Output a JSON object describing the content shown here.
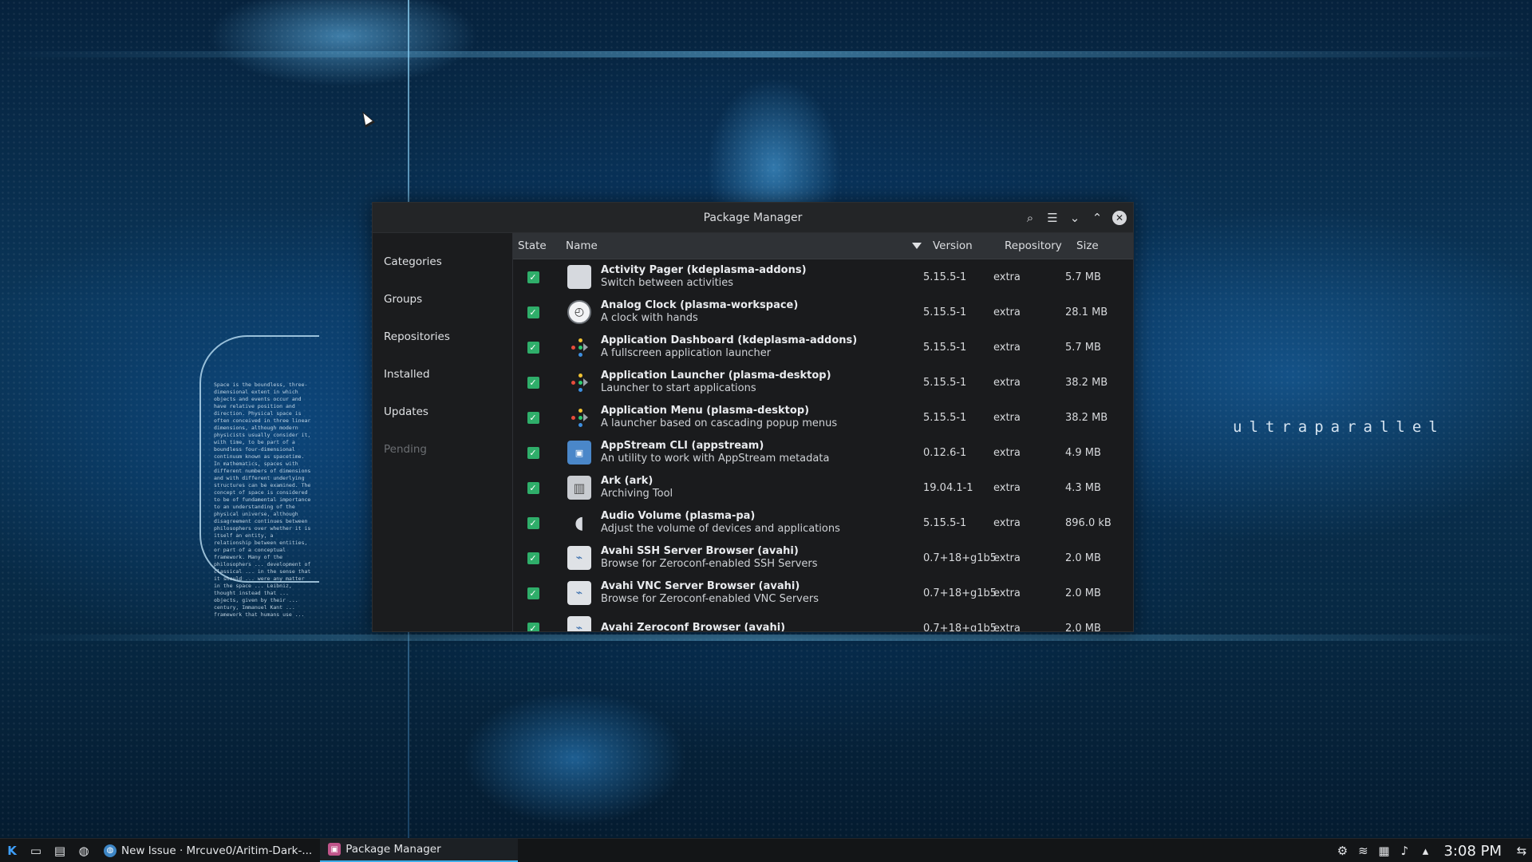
{
  "wallpaper": {
    "brand_text": "ultraparallel",
    "paragraph": "Space is the boundless, three-dimensional extent in which objects and events occur and have relative position and direction. Physical space is often conceived in three linear dimensions, although modern physicists usually consider it, with time, to be part of a boundless four-dimensional continuum known as spacetime. In mathematics, spaces with different numbers of dimensions and with different underlying structures can be examined. The concept of space is considered to be of fundamental importance to an understanding of the physical universe, although disagreement continues between philosophers over whether it is itself an entity, a relationship between entities, or part of a conceptual framework. Many of the philosophers ... development of classical ... in the sense that it should ... were any matter in the space ... Leibniz, thought instead that ... objects, given by their ... century, Immanuel Kant ... framework that humans use ..."
  },
  "window": {
    "title": "Package Manager",
    "controls": {
      "search": "⌕",
      "menu": "☰",
      "minimize": "⌄",
      "maximize": "⌃",
      "close": "✕"
    }
  },
  "sidebar": {
    "items": [
      {
        "label": "Categories",
        "enabled": true
      },
      {
        "label": "Groups",
        "enabled": true
      },
      {
        "label": "Repositories",
        "enabled": true
      },
      {
        "label": "Installed",
        "enabled": true
      },
      {
        "label": "Updates",
        "enabled": true
      },
      {
        "label": "Pending",
        "enabled": false
      }
    ]
  },
  "table": {
    "headers": {
      "state": "State",
      "name": "Name",
      "version": "Version",
      "repository": "Repository",
      "size": "Size"
    },
    "sort": {
      "column": "name",
      "direction": "descending-indicator"
    },
    "rows": [
      {
        "icon": "activity-pager-icon",
        "title": "Activity Pager  (kdeplasma-addons)",
        "desc": "Switch between activities",
        "version": "5.15.5-1",
        "repo": "extra",
        "size": "5.7 MB",
        "installed": true
      },
      {
        "icon": "analog-clock-icon",
        "title": "Analog Clock  (plasma-workspace)",
        "desc": "A clock with hands",
        "version": "5.15.5-1",
        "repo": "extra",
        "size": "28.1 MB",
        "installed": true
      },
      {
        "icon": "application-dashboard-icon",
        "title": "Application Dashboard  (kdeplasma-addons)",
        "desc": "A fullscreen application launcher",
        "version": "5.15.5-1",
        "repo": "extra",
        "size": "5.7 MB",
        "installed": true
      },
      {
        "icon": "application-launcher-icon",
        "title": "Application Launcher  (plasma-desktop)",
        "desc": "Launcher to start applications",
        "version": "5.15.5-1",
        "repo": "extra",
        "size": "38.2 MB",
        "installed": true
      },
      {
        "icon": "application-menu-icon",
        "title": "Application Menu  (plasma-desktop)",
        "desc": "A launcher based on cascading popup menus",
        "version": "5.15.5-1",
        "repo": "extra",
        "size": "38.2 MB",
        "installed": true
      },
      {
        "icon": "appstream-icon",
        "title": "AppStream CLI  (appstream)",
        "desc": "An utility to work with AppStream metadata",
        "version": "0.12.6-1",
        "repo": "extra",
        "size": "4.9 MB",
        "installed": true
      },
      {
        "icon": "ark-icon",
        "title": "Ark  (ark)",
        "desc": "Archiving Tool",
        "version": "19.04.1-1",
        "repo": "extra",
        "size": "4.3 MB",
        "installed": true
      },
      {
        "icon": "audio-volume-icon",
        "title": "Audio Volume  (plasma-pa)",
        "desc": "Adjust the volume of devices and applications",
        "version": "5.15.5-1",
        "repo": "extra",
        "size": "896.0 kB",
        "installed": true
      },
      {
        "icon": "avahi-ssh-icon",
        "title": "Avahi SSH Server Browser  (avahi)",
        "desc": "Browse for Zeroconf-enabled SSH Servers",
        "version": "0.7+18+g1b5",
        "repo": "extra",
        "size": "2.0 MB",
        "installed": true
      },
      {
        "icon": "avahi-vnc-icon",
        "title": "Avahi VNC Server Browser  (avahi)",
        "desc": "Browse for Zeroconf-enabled VNC Servers",
        "version": "0.7+18+g1b5",
        "repo": "extra",
        "size": "2.0 MB",
        "installed": true
      },
      {
        "icon": "avahi-zeroconf-icon",
        "title": "Avahi Zeroconf Browser  (avahi)",
        "desc": "",
        "version": "0.7+18+g1b5",
        "repo": "extra",
        "size": "2.0 MB",
        "installed": true
      }
    ]
  },
  "taskbar": {
    "launcher_icon": "K",
    "tasks": [
      {
        "label": "New Issue · Mrcuve0/Aritim-Dark-...",
        "icon": "browser-icon",
        "active": false
      },
      {
        "label": "Package Manager",
        "icon": "package-manager-icon",
        "active": true
      }
    ],
    "clock": "3:08 PM"
  },
  "colors": {
    "accent": "#3daee9",
    "checkbox": "#2fae6a",
    "window_bg": "#1e1f21"
  }
}
